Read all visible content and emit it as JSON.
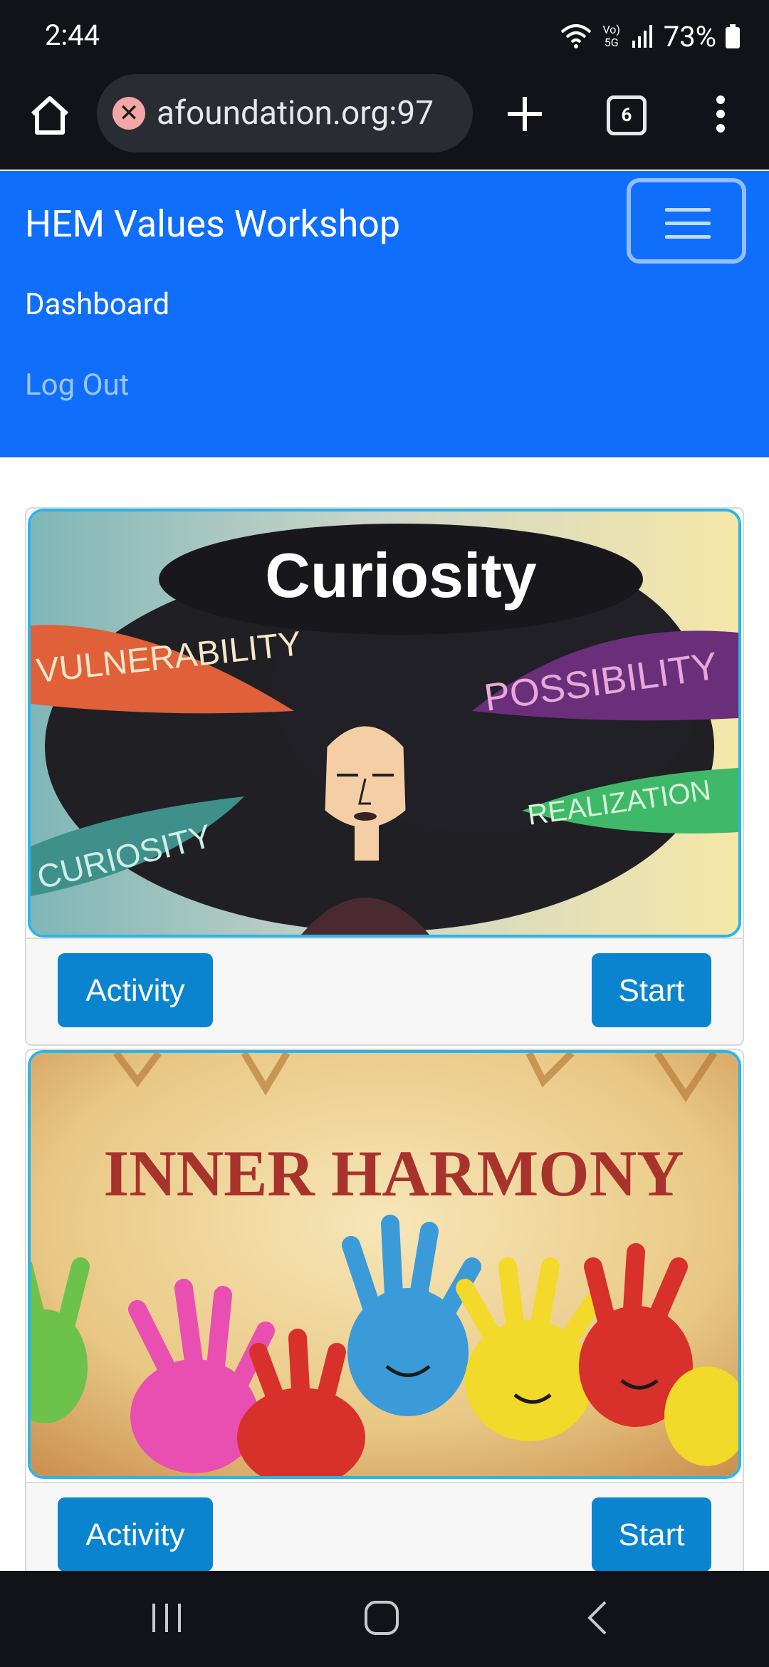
{
  "status_bar": {
    "time": "2:44",
    "network_label": "Vo) 5G",
    "battery": "73%"
  },
  "browser": {
    "url": "afoundation.org:97",
    "tab_count": "6"
  },
  "navbar": {
    "brand": "HEM Values Workshop",
    "links": [
      "Dashboard",
      "Log Out"
    ]
  },
  "cards": [
    {
      "image_title": "Curiosity",
      "image_words": [
        "VULNERABILITY",
        "POSSIBILITY",
        "CURIOSITY",
        "REALIZATION"
      ],
      "activity_label": "Activity",
      "start_label": "Start"
    },
    {
      "image_title": "INNER HARMONY",
      "activity_label": "Activity",
      "start_label": "Start"
    }
  ],
  "colors": {
    "navbar": "#106efd",
    "button": "#0b84cf",
    "image_border": "#29b5e8",
    "system_bar": "#121318"
  }
}
